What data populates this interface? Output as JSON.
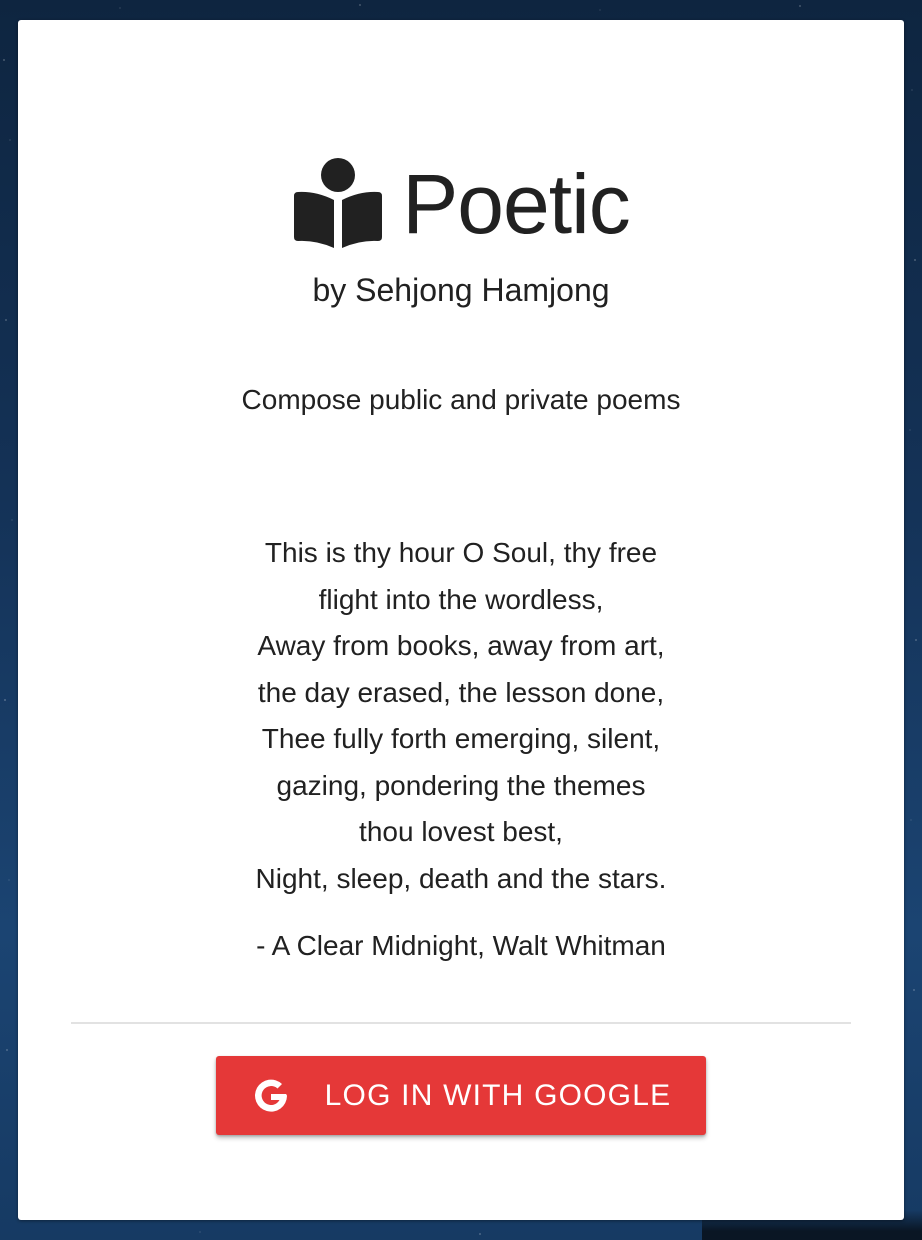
{
  "app": {
    "title": "Poetic",
    "icon": "book-reader-icon",
    "author": "by Sehjong Hamjong",
    "tagline": "Compose public and private poems"
  },
  "poem": {
    "lines": [
      "This is thy hour O Soul, thy free",
      "flight into the wordless,",
      "Away from books, away from art,",
      "the day erased, the lesson done,",
      "Thee fully forth emerging, silent,",
      "gazing, pondering the themes",
      "thou lovest best,",
      "Night, sleep, death and the stars."
    ],
    "attribution": "- A Clear Midnight, Walt Whitman"
  },
  "login": {
    "label": "LOG IN WITH GOOGLE",
    "icon": "google-icon"
  },
  "colors": {
    "card_background": "#ffffff",
    "text": "#212121",
    "button": "#e53838",
    "button_text": "#ffffff",
    "divider": "#e2e2e2",
    "page_background": "#143257"
  }
}
